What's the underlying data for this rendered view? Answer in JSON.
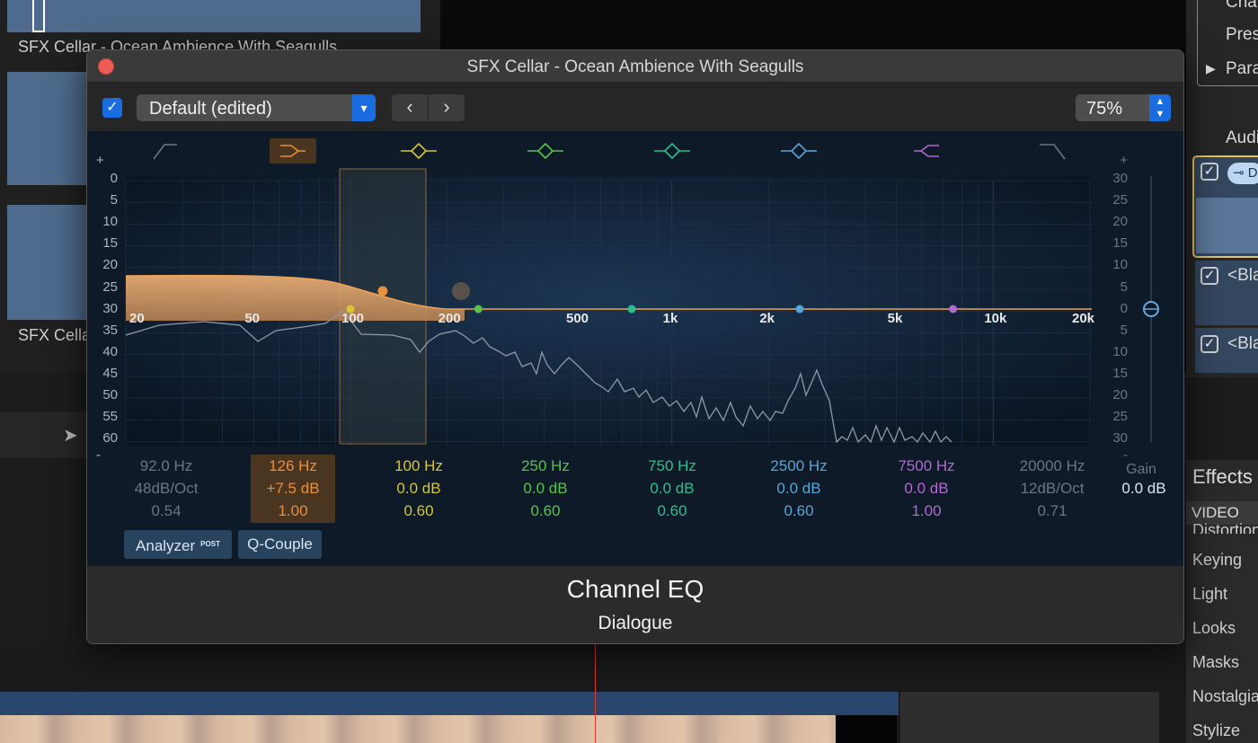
{
  "background": {
    "browser_clips": [
      {
        "label": "SFX Cellar - Ocean Ambience With Seagulls"
      },
      {
        "label": "SFX Cellar"
      }
    ],
    "inspector": {
      "items": [
        "Cha",
        "Pres",
        "Para"
      ],
      "audio_label": "Audi",
      "effect_checkboxes": [
        "D",
        "<Bla",
        "<Bla"
      ]
    },
    "effects_browser": {
      "title": "Effects",
      "section": "VIDEO",
      "categories": [
        "Distortion",
        "Keying",
        "Light",
        "Looks",
        "Masks",
        "Nostalgia",
        "Stylize"
      ]
    }
  },
  "window": {
    "title": "SFX Cellar - Ocean Ambience With Seagulls",
    "enabled": true,
    "preset": "Default (edited)",
    "zoom": "75%",
    "plugin_name": "Channel EQ",
    "plugin_subtitle": "Dialogue"
  },
  "eq": {
    "left_scale": [
      "+",
      "0",
      "5",
      "10",
      "15",
      "20",
      "25",
      "30",
      "35",
      "40",
      "45",
      "50",
      "55",
      "60",
      "-"
    ],
    "right_scale": [
      "+",
      "30",
      "25",
      "20",
      "15",
      "10",
      "5",
      "0",
      "5",
      "10",
      "15",
      "20",
      "25",
      "30",
      "-"
    ],
    "freq_labels": [
      "20",
      "50",
      "100",
      "200",
      "500",
      "1k",
      "2k",
      "5k",
      "10k",
      "20k"
    ],
    "bands": [
      {
        "freq": "92.0 Hz",
        "gain": "48dB/Oct",
        "q": "0.54",
        "color": "#6a7684",
        "type": "high-pass",
        "active": false
      },
      {
        "freq": "126 Hz",
        "gain": "+7.5 dB",
        "q": "1.00",
        "color": "#e8903a",
        "type": "low-shelf",
        "active": true
      },
      {
        "freq": "100 Hz",
        "gain": "0.0 dB",
        "q": "0.60",
        "color": "#d8c636",
        "type": "bell",
        "active": false
      },
      {
        "freq": "250 Hz",
        "gain": "0.0 dB",
        "q": "0.60",
        "color": "#5ac24e",
        "type": "bell",
        "active": false
      },
      {
        "freq": "750 Hz",
        "gain": "0.0 dB",
        "q": "0.60",
        "color": "#2ec08a",
        "type": "bell",
        "active": false
      },
      {
        "freq": "2500 Hz",
        "gain": "0.0 dB",
        "q": "0.60",
        "color": "#5aa6d6",
        "type": "bell",
        "active": false
      },
      {
        "freq": "7500 Hz",
        "gain": "0.0 dB",
        "q": "1.00",
        "color": "#b06ad0",
        "type": "high-shelf",
        "active": false
      },
      {
        "freq": "20000 Hz",
        "gain": "12dB/Oct",
        "q": "0.71",
        "color": "#6a7684",
        "type": "low-pass",
        "active": false
      }
    ],
    "gain_label": "Gain",
    "gain_value": "0.0 dB",
    "buttons": {
      "analyzer": "Analyzer",
      "analyzer_tag": "POST",
      "q_couple": "Q-Couple"
    }
  }
}
